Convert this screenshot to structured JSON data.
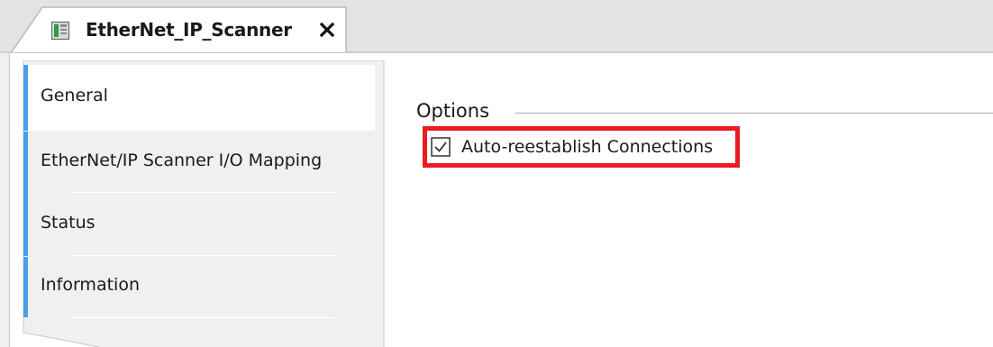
{
  "document_tab": {
    "title": "EtherNet_IP_Scanner",
    "icon": "device-module-icon",
    "close_icon": "close-icon"
  },
  "nav": {
    "items": [
      {
        "label": "General",
        "selected": true
      },
      {
        "label": "EtherNet/IP Scanner I/O Mapping",
        "selected": false
      },
      {
        "label": "Status",
        "selected": false
      },
      {
        "label": "Information",
        "selected": false
      }
    ]
  },
  "options_group": {
    "title": "Options",
    "auto_reestablish": {
      "label": "Auto-reestablish Connections",
      "checked": true
    }
  },
  "colors": {
    "accent": "#4a9fe8",
    "highlight": "#ea1c24"
  }
}
